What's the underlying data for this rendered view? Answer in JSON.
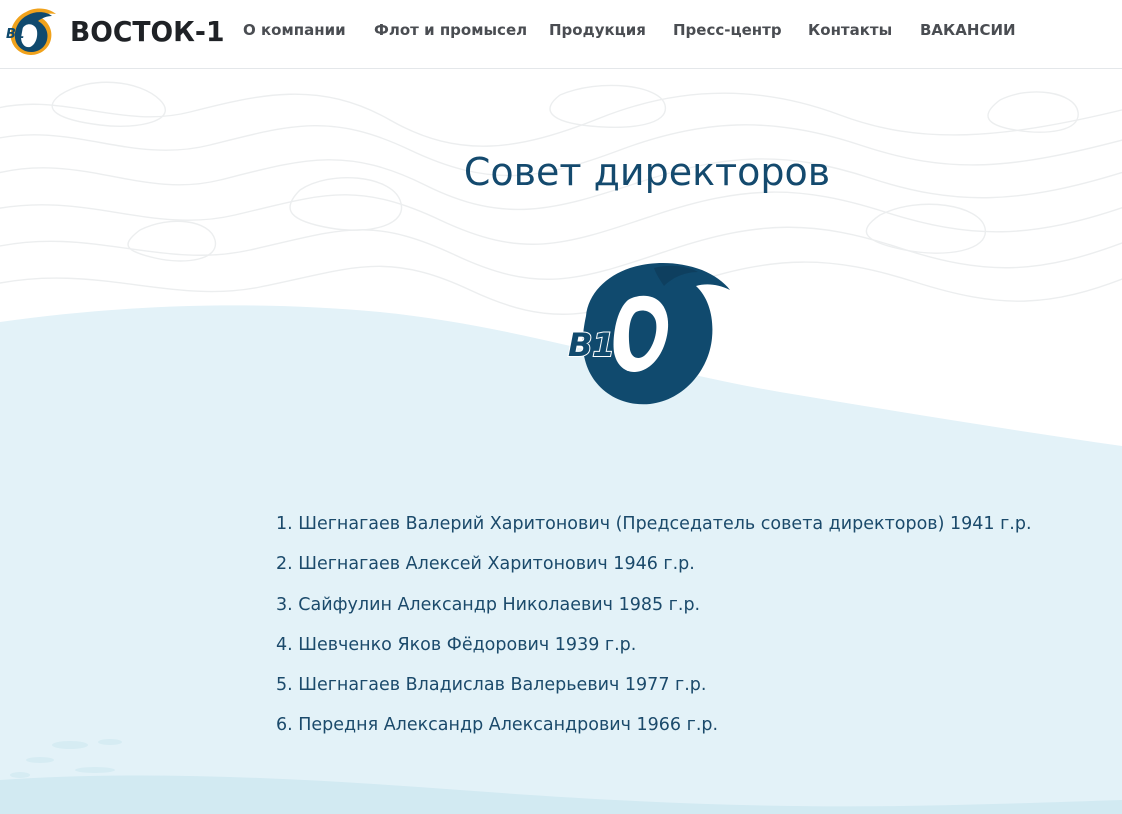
{
  "header": {
    "brand_name": "ВОСТОК-1",
    "logo_text": "В1",
    "nav": [
      {
        "label": "О компании"
      },
      {
        "label": "Флот и промысел"
      },
      {
        "label": "Продукция"
      },
      {
        "label": "Пресс-центр"
      },
      {
        "label": "Контакты"
      },
      {
        "label": "ВАКАНСИИ"
      }
    ]
  },
  "main": {
    "title": "Совет директоров",
    "logo_text": "В1",
    "directors": [
      "1. Шегнагаев Валерий Харитонович (Председатель совета директоров) 1941 г.р.",
      "2. Шегнагаев Алексей Харитонович 1946 г.р.",
      "3. Сайфулин Александр Николаевич 1985 г.р.",
      "4. Шевченко Яков Фёдорович 1939 г.р.",
      "5. Шегнагаев Владислав Валерьевич 1977 г.р.",
      "6. Передня Александр Александрович 1966 г.р."
    ]
  },
  "colors": {
    "brand_blue": "#104a6e",
    "logo_orange": "#f0a21c",
    "wave_light": "#e3f2f8",
    "nav_text": "#4a4d52"
  }
}
